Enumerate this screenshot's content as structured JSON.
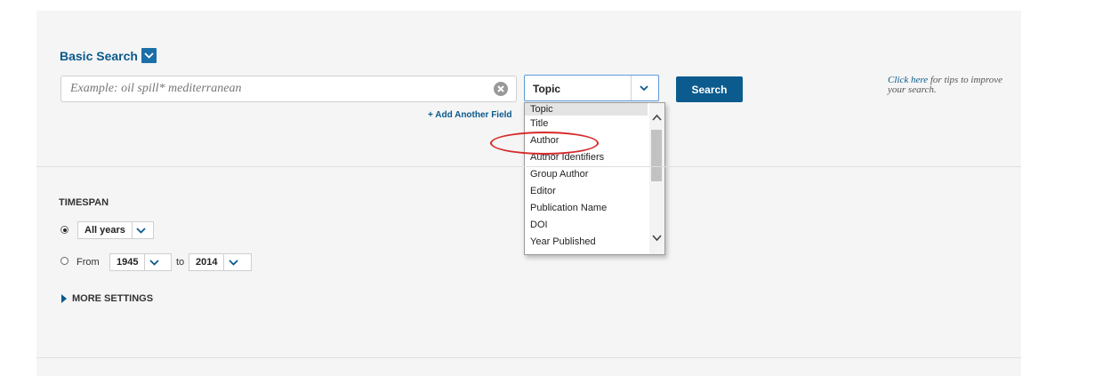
{
  "basic_search": {
    "label": "Basic Search"
  },
  "search": {
    "placeholder": "Example: oil spill* mediterranean",
    "add_field": "+ Add Another Field",
    "field_value": "Topic",
    "button": "Search"
  },
  "tips": {
    "link": "Click here",
    "rest": " for tips to improve your search."
  },
  "dropdown": {
    "options": [
      "Topic",
      "Title",
      "Author",
      "Author Identifiers",
      "Group Author",
      "Editor",
      "Publication Name",
      "DOI",
      "Year Published"
    ],
    "highlighted": "Author"
  },
  "timespan": {
    "title": "TIMESPAN",
    "all_years": "All years",
    "from_label": "From",
    "from_year": "1945",
    "to_label": "to",
    "to_year": "2014",
    "more_settings": "MORE SETTINGS"
  },
  "colors": {
    "accent": "#0c5b8e",
    "annotation": "#d62a2a"
  }
}
